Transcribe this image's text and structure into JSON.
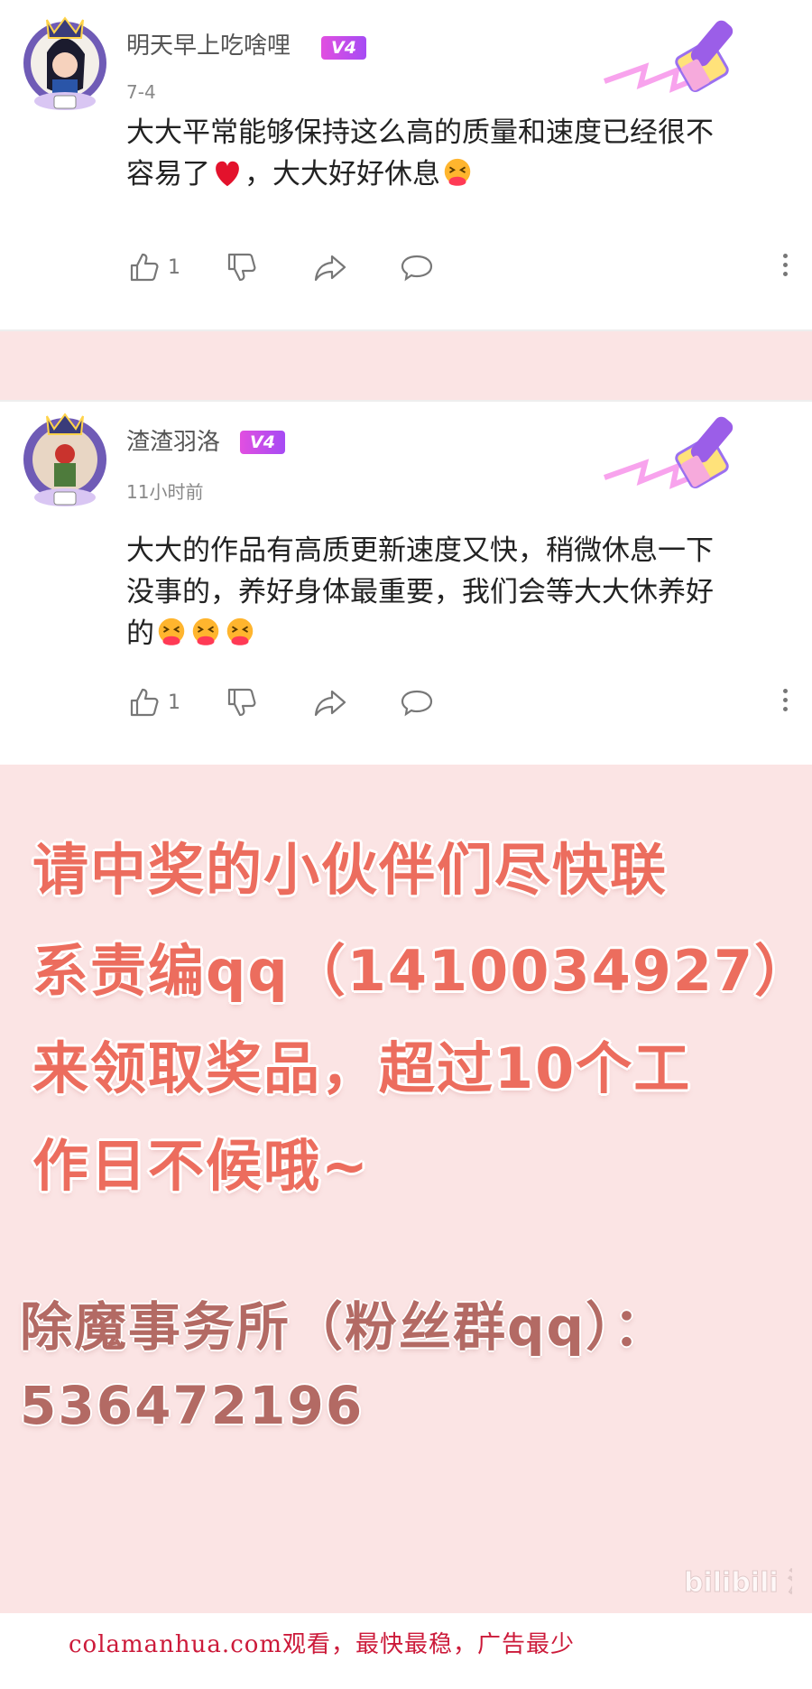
{
  "comments": [
    {
      "username": "明天早上吃啥哩",
      "level": "V4",
      "time": "7-4",
      "text_line1": "大大平常能够保持这么高的质量和速度已经很不",
      "text_line2_a": "容易了",
      "text_line2_b": "，大大好好休息",
      "likes": "1"
    },
    {
      "username": "渣渣羽洛",
      "level": "V4",
      "time": "11小时前",
      "text_line1": "大大的作品有高质更新速度又快，稍微休息一下",
      "text_line2": "没事的，养好身体最重要，我们会等大大休养好",
      "text_line3": "的",
      "likes": "1"
    }
  ],
  "icons": {
    "like": "thumbs-up-icon",
    "dislike": "thumbs-down-icon",
    "share": "share-icon",
    "reply": "reply-icon",
    "more": "more-vertical-icon",
    "heart": "red-heart-emoji",
    "hug": "hugging-face-emoji"
  },
  "notice": {
    "line1": "请中奖的小伙伴们尽快联",
    "line2": "系责编qq（1410034927）",
    "line3": "来领取奖品，超过10个工",
    "line4": "作日不候哦~",
    "group_line1": "除魔事务所（粉丝群qq）：",
    "group_line2": "536472196",
    "watermark": "bilibili 漫画"
  },
  "footer": {
    "text": "colamanhua.com观看，最快最稳，广告最少"
  },
  "colors": {
    "notice_bg": "#fbe4e4",
    "notice_text": "#ec6d5e",
    "group_text": "#b36a64",
    "badge": "#c44ef0",
    "footer_text": "#cc1a3a"
  }
}
